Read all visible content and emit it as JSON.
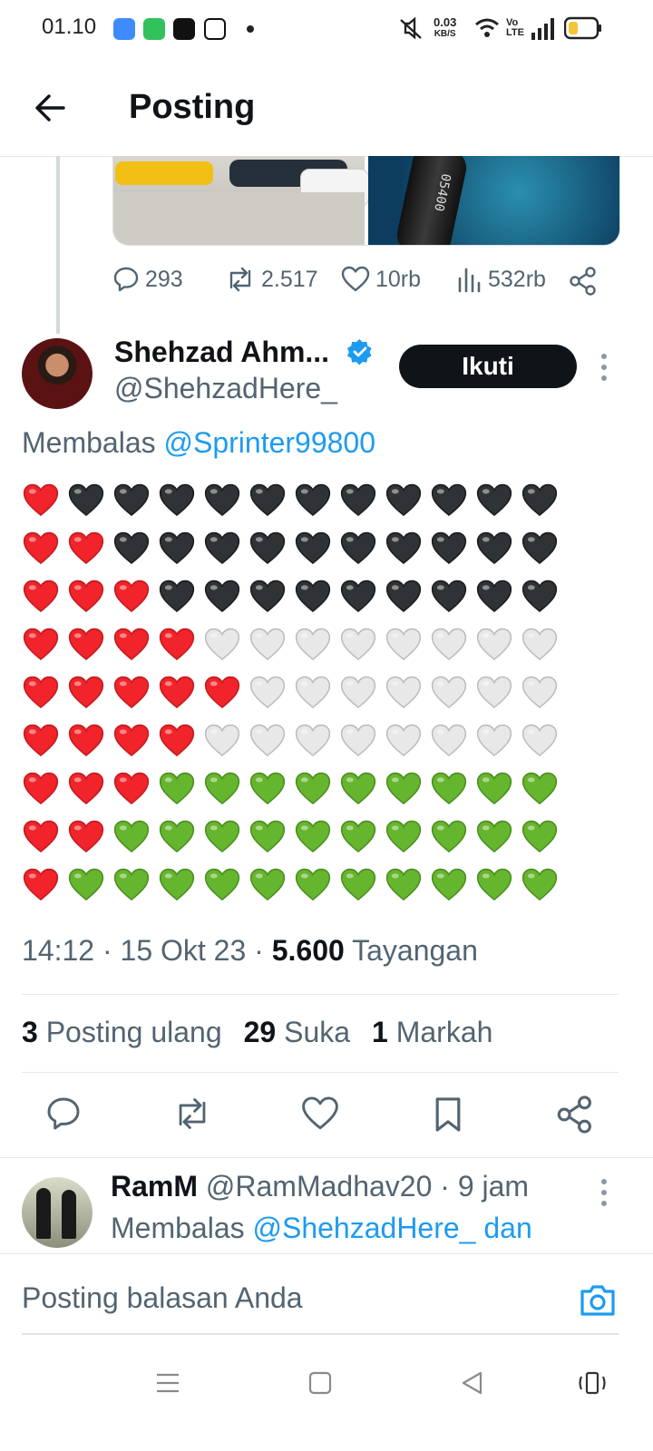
{
  "status_bar": {
    "time": "01.10",
    "speed_value": "0.03",
    "speed_unit": "KB/S"
  },
  "header": {
    "title": "Posting"
  },
  "parent_tweet_stats": {
    "replies": "293",
    "reposts": "2.517",
    "likes": "10rb",
    "views": "532rb"
  },
  "tweet": {
    "author_name": "Shehzad Ahm...",
    "author_handle": "@ShehzadHere_",
    "follow_label": "Ikuti",
    "reply_prefix": "Membalas",
    "reply_to": "@Sprinter99800",
    "hearts": [
      [
        "red",
        "black",
        "black",
        "black",
        "black",
        "black",
        "black",
        "black",
        "black",
        "black",
        "black",
        "black"
      ],
      [
        "red",
        "red",
        "black",
        "black",
        "black",
        "black",
        "black",
        "black",
        "black",
        "black",
        "black",
        "black"
      ],
      [
        "red",
        "red",
        "red",
        "black",
        "black",
        "black",
        "black",
        "black",
        "black",
        "black",
        "black",
        "black"
      ],
      [
        "red",
        "red",
        "red",
        "red",
        "white",
        "white",
        "white",
        "white",
        "white",
        "white",
        "white",
        "white"
      ],
      [
        "red",
        "red",
        "red",
        "red",
        "red",
        "white",
        "white",
        "white",
        "white",
        "white",
        "white",
        "white"
      ],
      [
        "red",
        "red",
        "red",
        "red",
        "white",
        "white",
        "white",
        "white",
        "white",
        "white",
        "white",
        "white"
      ],
      [
        "red",
        "red",
        "red",
        "green",
        "green",
        "green",
        "green",
        "green",
        "green",
        "green",
        "green",
        "green"
      ],
      [
        "red",
        "red",
        "green",
        "green",
        "green",
        "green",
        "green",
        "green",
        "green",
        "green",
        "green",
        "green"
      ],
      [
        "red",
        "green",
        "green",
        "green",
        "green",
        "green",
        "green",
        "green",
        "green",
        "green",
        "green",
        "green"
      ]
    ],
    "time": "14:12",
    "date": "15 Okt 23",
    "views_count": "5.600",
    "views_label": "Tayangan",
    "reposts_count": "3",
    "reposts_label": "Posting ulang",
    "likes_count": "29",
    "likes_label": "Suka",
    "bookmarks_count": "1",
    "bookmarks_label": "Markah"
  },
  "reply": {
    "name": "RamM",
    "handle": "@RamMadhav20",
    "age": "9 jam",
    "reply_prefix": "Membalas",
    "reply_to": "@ShehzadHere_ dan"
  },
  "compose": {
    "placeholder": "Posting balasan Anda"
  },
  "colors": {
    "accent": "#1d9bf0",
    "text": "#0f1419",
    "muted": "#536471",
    "heart_red": "#f0242a",
    "heart_black": "#2f3336",
    "heart_white": "#e8e8e8",
    "heart_green": "#66b52e"
  }
}
